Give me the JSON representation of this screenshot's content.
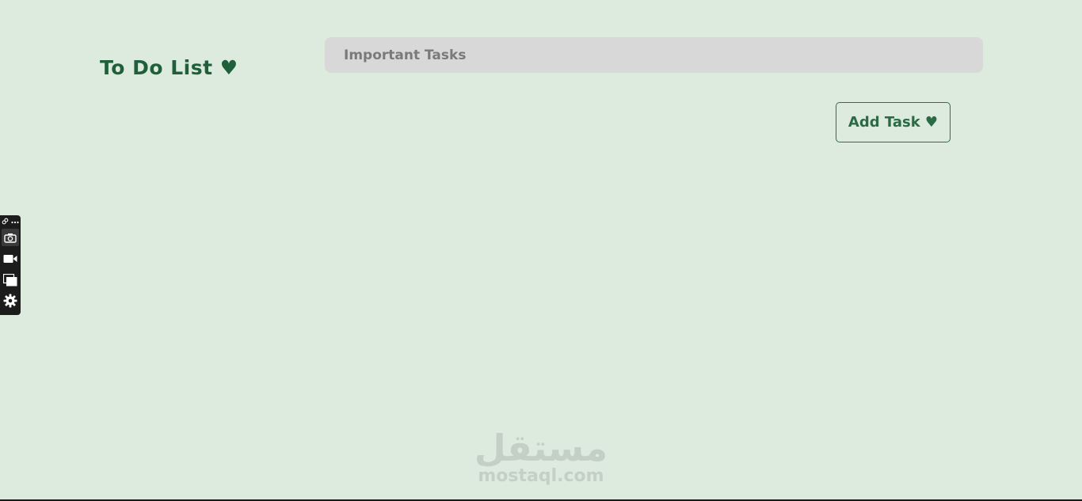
{
  "app": {
    "title": "To Do List ♥"
  },
  "task_form": {
    "input_placeholder": "Important Tasks",
    "input_value": "",
    "add_label": "Add Task ♥"
  },
  "capture_toolbar": {
    "icons": [
      "link-icon",
      "more-icon",
      "camera-icon",
      "video-icon",
      "windows-icon",
      "settings-icon"
    ]
  },
  "watermark": {
    "arabic": "مستقل",
    "latin": "mostaql.com"
  },
  "colors": {
    "background": "#dcebde",
    "accent": "#1f5f3a",
    "input_bg": "#d8d8d8"
  }
}
